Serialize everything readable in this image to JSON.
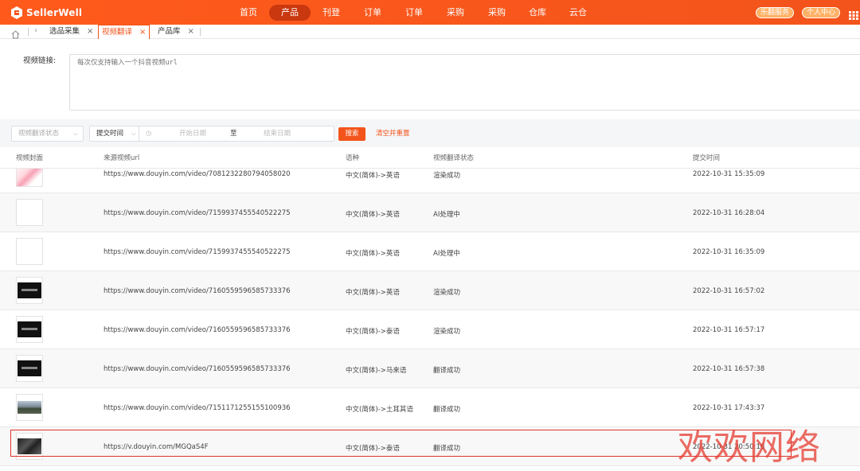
{
  "app": {
    "brand": "SellerWell"
  },
  "nav": {
    "items": [
      {
        "label": "首页",
        "active": false
      },
      {
        "label": "产品",
        "active": true
      },
      {
        "label": "刊登",
        "active": false
      },
      {
        "label": "订单",
        "active": false
      },
      {
        "label": "订单",
        "active": false
      },
      {
        "label": "采购",
        "active": false
      },
      {
        "label": "采购",
        "active": false
      },
      {
        "label": "仓库",
        "active": false
      },
      {
        "label": "云仓",
        "active": false
      }
    ],
    "service_label": "乐翻服务",
    "profile_label": "个人中心"
  },
  "tabs": [
    {
      "label": "选品采集",
      "active": false
    },
    {
      "label": "视频翻译",
      "active": true
    },
    {
      "label": "产品库",
      "active": false
    }
  ],
  "form": {
    "url_label": "视频链接:",
    "url_placeholder": "每次仅支持输入一个抖音视频url"
  },
  "filters": {
    "status_placeholder": "视频翻译状态",
    "time_type": "提交时间",
    "start_placeholder": "开始日期",
    "range_sep": "至",
    "end_placeholder": "结束日期",
    "search_label": "搜索",
    "reset_label": "清空并重置"
  },
  "table": {
    "headers": [
      "视频封面",
      "来源视频url",
      "语种",
      "视频翻译状态",
      "提交时间"
    ],
    "rows": [
      {
        "thumb": "pink",
        "url": "https://www.douyin.com/video/7081232280794058020",
        "lang": "中文(简体)->英语",
        "status": "渲染成功",
        "time": "2022-10-31 15:35:09"
      },
      {
        "thumb": "blank",
        "url": "https://www.douyin.com/video/7159937455540522275",
        "lang": "中文(简体)->英语",
        "status": "AI处理中",
        "time": "2022-10-31 16:28:04"
      },
      {
        "thumb": "blank",
        "url": "https://www.douyin.com/video/7159937455540522275",
        "lang": "中文(简体)->英语",
        "status": "AI处理中",
        "time": "2022-10-31 16:35:09"
      },
      {
        "thumb": "black",
        "url": "https://www.douyin.com/video/7160559596585733376",
        "lang": "中文(简体)->英语",
        "status": "渲染成功",
        "time": "2022-10-31 16:57:02"
      },
      {
        "thumb": "black",
        "url": "https://www.douyin.com/video/7160559596585733376",
        "lang": "中文(简体)->泰语",
        "status": "渲染成功",
        "time": "2022-10-31 16:57:17"
      },
      {
        "thumb": "black",
        "url": "https://www.douyin.com/video/7160559596585733376",
        "lang": "中文(简体)->马来语",
        "status": "翻译成功",
        "time": "2022-10-31 16:57:38"
      },
      {
        "thumb": "scene",
        "url": "https://www.douyin.com/video/7151171255155100936",
        "lang": "中文(简体)->土耳其语",
        "status": "翻译成功",
        "time": "2022-10-31 17:43:37"
      },
      {
        "thumb": "dark",
        "url": "https://v.douyin.com/MGQaS4F",
        "lang": "中文(简体)->泰语",
        "status": "翻译成功",
        "time": "2022-10-31 20:50:16"
      }
    ]
  },
  "watermark": "欢欢网络",
  "colors": {
    "brand": "#f3541b",
    "highlight": "#e0342b"
  }
}
